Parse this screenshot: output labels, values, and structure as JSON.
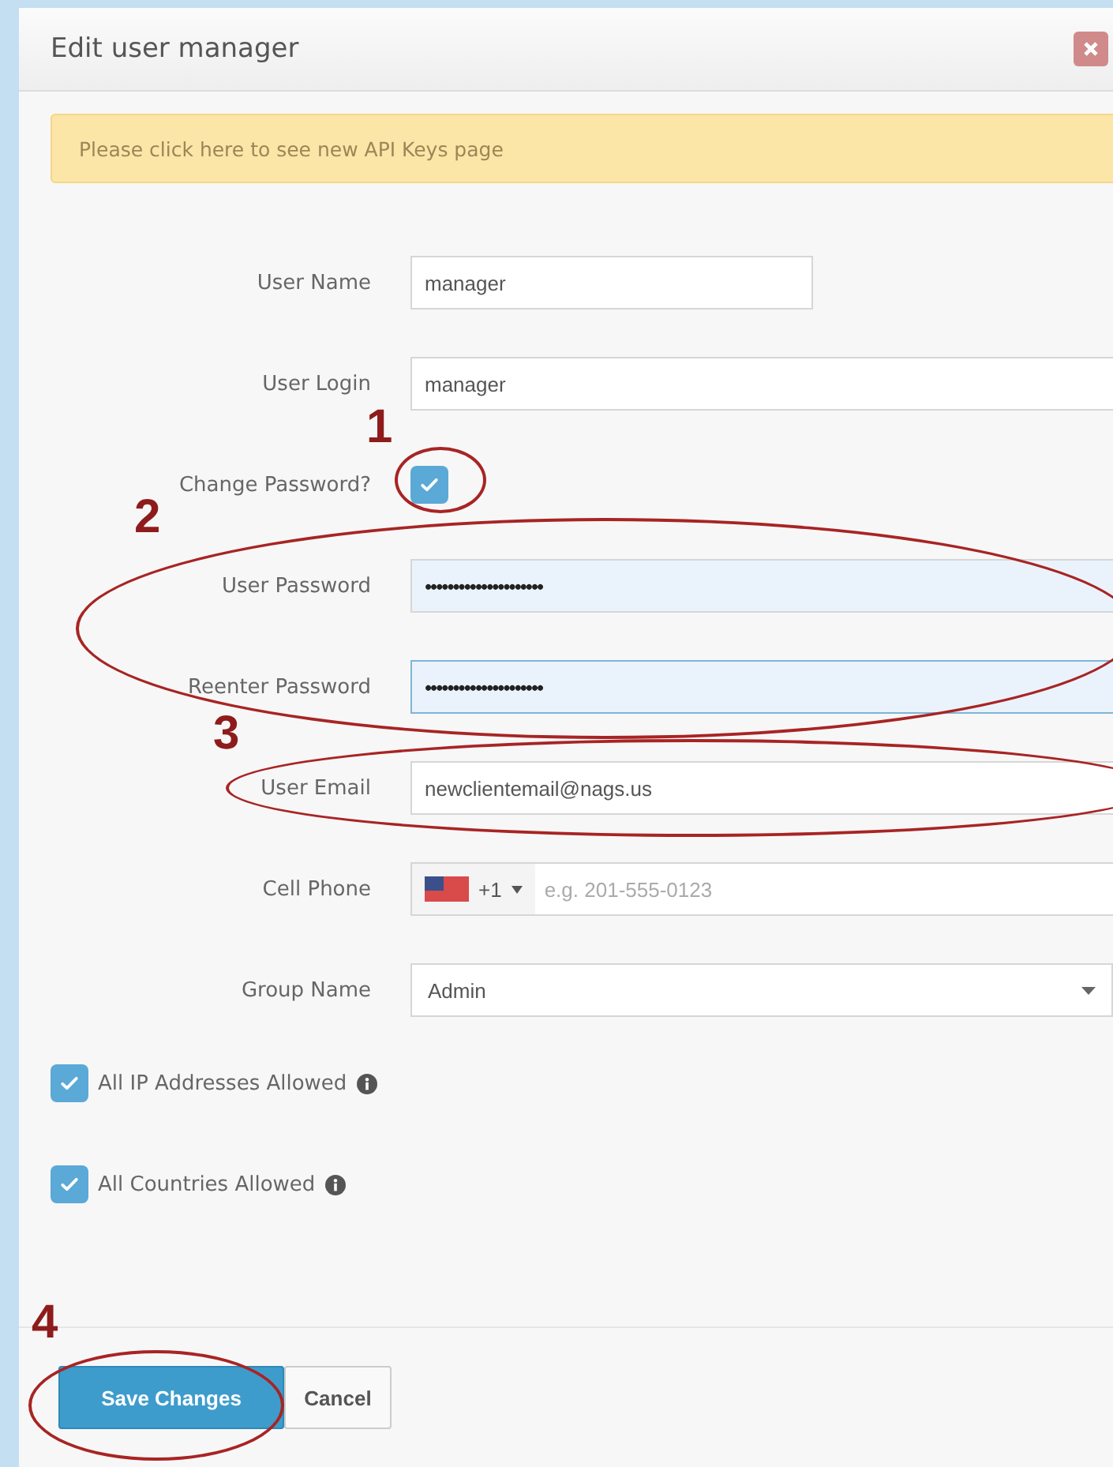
{
  "dialog": {
    "title": "Edit user manager"
  },
  "alert": {
    "text": "Please click here to see new API Keys page"
  },
  "fields": [
    {
      "kind": "text",
      "label": "User Name",
      "value": "manager",
      "short": true
    },
    {
      "kind": "text",
      "label": "User Login",
      "value": "manager",
      "short": false
    },
    {
      "kind": "checkbox",
      "label": "Change Password?",
      "checked": true
    },
    {
      "kind": "password",
      "label": "User Password",
      "value": "•••••••••••••••••••••",
      "focused": false
    },
    {
      "kind": "password",
      "label": "Reenter Password",
      "value": "•••••••••••••••••••••",
      "focused": true
    },
    {
      "kind": "text",
      "label": "User Email",
      "value": "newclientemail@nags.us",
      "short": false
    },
    {
      "kind": "phone",
      "label": "Cell Phone",
      "code": "+1",
      "placeholder": "e.g. 201-555-0123"
    },
    {
      "kind": "select",
      "label": "Group Name",
      "value": "Admin"
    }
  ],
  "options": [
    {
      "label": "All IP Addresses Allowed",
      "checked": true
    },
    {
      "label": "All Countries Allowed",
      "checked": true
    }
  ],
  "buttons": [
    {
      "label": "Save Changes",
      "kind": "primary"
    },
    {
      "label": "Cancel",
      "kind": "default"
    }
  ],
  "annotations": [
    {
      "label": "1"
    },
    {
      "label": "2"
    },
    {
      "label": "3"
    },
    {
      "label": "4"
    }
  ]
}
